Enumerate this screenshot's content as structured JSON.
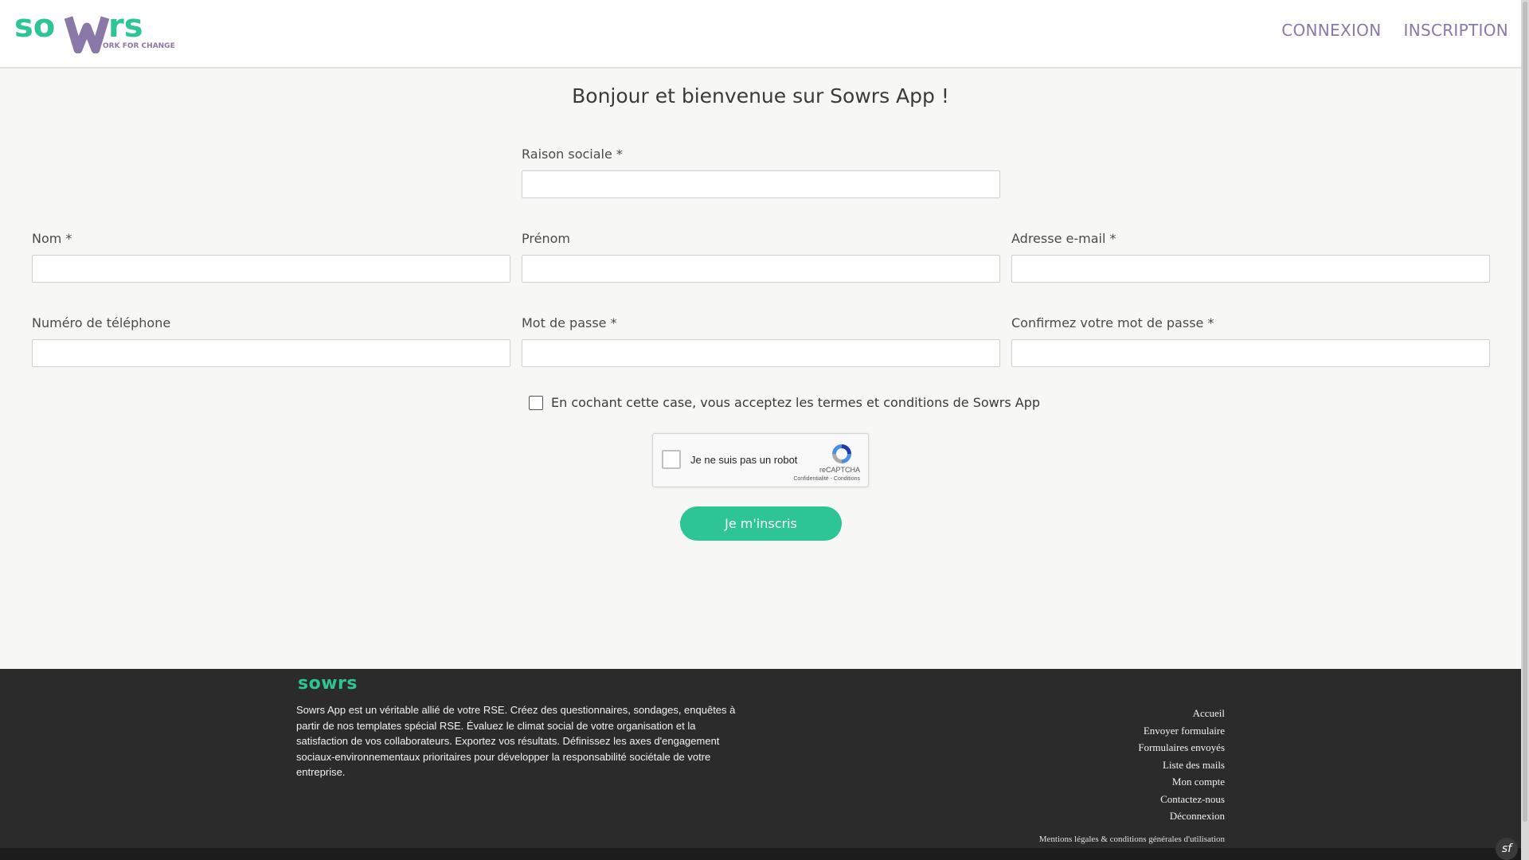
{
  "header": {
    "logo_text": "sowrs",
    "logo_tagline": "ORK FOR CHANGE",
    "nav": {
      "login": "CONNEXION",
      "signup": "INSCRIPTION"
    }
  },
  "main": {
    "title": "Bonjour et bienvenue sur Sowrs App !",
    "fields": {
      "company": {
        "label": "Raison sociale *",
        "value": ""
      },
      "last_name": {
        "label": "Nom *",
        "value": ""
      },
      "first_name": {
        "label": "Prénom",
        "value": ""
      },
      "email": {
        "label": "Adresse e-mail *",
        "value": ""
      },
      "phone": {
        "label": "Numéro de téléphone",
        "value": ""
      },
      "password": {
        "label": "Mot de passe *",
        "value": ""
      },
      "password_confirm": {
        "label": "Confirmez votre mot de passe *",
        "value": ""
      }
    },
    "terms_label": "En cochant cette case, vous acceptez les termes et conditions de Sowrs App",
    "recaptcha": {
      "label": "Je ne suis pas un robot",
      "brand": "reCAPTCHA",
      "links": "Confidentialité - Conditions"
    },
    "submit_label": "Je m'inscris"
  },
  "footer": {
    "logo_text": "sowrs",
    "description": "Sowrs App est un véritable allié de votre RSE. Créez des questionnaires, sondages, enquêtes à partir de nos templates spécial RSE. Évaluez le climat social de votre organisation et la satisfaction de vos collaborateurs. Exportez vos résultats. Définissez les axes d'engagement sociaux-environnementaux prioritaires pour développer la responsabilité sociétale de votre entreprise.",
    "links": [
      "Accueil",
      "Envoyer formulaire",
      "Formulaires envoyés",
      "Liste des mails",
      "Mon compte",
      "Contactez-nous",
      "Déconnexion"
    ],
    "legal": "Mentions légales & conditions générales d'utilisation"
  },
  "colors": {
    "brand_green": "#2ec594",
    "brand_purple": "#8a78a8",
    "footer_bg": "#2b2b2b"
  }
}
